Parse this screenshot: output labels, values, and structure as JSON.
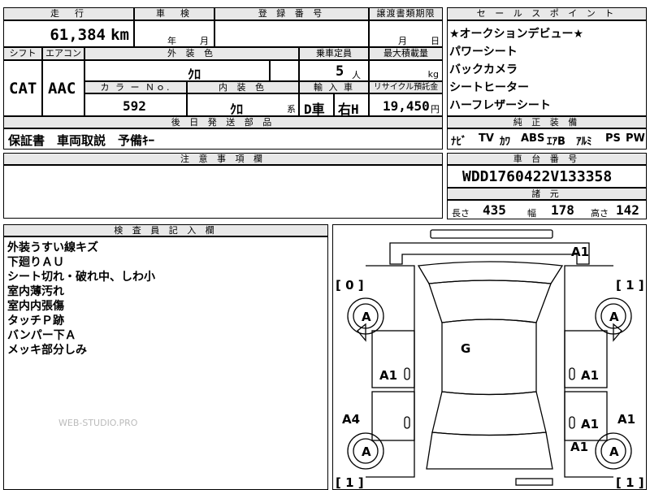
{
  "top": {
    "mileage_header": "走　行",
    "inspection_header": "車　検",
    "registration_header": "登 録 番 号",
    "transfer_header": "譲渡書類期限",
    "mileage_value": "61,384",
    "mileage_unit": "km",
    "year_label": "年",
    "month_label": "月",
    "transfer_month_label": "月",
    "transfer_day_label": "日"
  },
  "specs": {
    "shift_header": "シフト",
    "ac_header": "エアコン",
    "exterior_header": "外 装 色",
    "capacity_header": "乗車定員",
    "load_header": "最大積載量",
    "shift_value": "CAT",
    "ac_value": "AAC",
    "exterior_value": "ｸﾛ",
    "capacity_value": "5",
    "capacity_unit": "人",
    "load_unit": "kg",
    "color_no_header": "カ ラ ー Ｎｏ.",
    "interior_header": "内 装 色",
    "import_header": "輸 入 車",
    "recycle_header": "リサイクル預託金",
    "color_no_value": "592",
    "interior_value": "ｸﾛ",
    "interior_suffix": "系",
    "import_type": "D車",
    "steering": "右H",
    "recycle_value": "19,450",
    "recycle_unit": "円"
  },
  "later_parts": {
    "header": "後 日 発 送 部 品",
    "value": "保証書　車両取説　予備ｷｰ"
  },
  "sale_points": {
    "header": "セ ー ル ス ポ イ ン ト",
    "items": [
      "★オークションデビュー★",
      "パワーシート",
      "バックカメラ",
      "シートヒーター",
      "ハーフレザーシート"
    ]
  },
  "equipment": {
    "header": "純 正 装 備",
    "items": [
      "ﾅﾋﾞ",
      "TV",
      "ｶﾜ",
      "ABS",
      "ｴｱB",
      "ｱﾙﾐ",
      "PS",
      "PW"
    ]
  },
  "notes": {
    "header": "注 意 事 項 欄"
  },
  "chassis": {
    "header": "車 台 番 号",
    "value": "WDD1760422V133358",
    "dims_header": "諸 元",
    "length_label": "長さ",
    "length_value": "435",
    "width_label": "幅",
    "width_value": "178",
    "height_label": "高さ",
    "height_value": "142"
  },
  "inspector": {
    "header": "検 査 員 記 入 欄",
    "lines": [
      "外装うすい線キズ",
      "下廻りＡＵ",
      "シート切れ・破れ中、しわ小",
      "室内薄汚れ",
      "室内内張傷",
      "タッチＰ跡",
      "バンパー下Ａ",
      "メッキ部分しみ"
    ],
    "watermark": "WEB-STUDIO.PRO"
  },
  "diagram": {
    "marks": {
      "front_bumper": "A1",
      "left_front_tire": "[ 0 ]",
      "right_front_tire": "[ 1 ]",
      "left_front_wheel": "A",
      "right_front_wheel": "A",
      "roof": "G",
      "left_front_door": "A1",
      "right_front_door": "A1",
      "left_rear_quarter": "A4",
      "right_rear_door": "A1",
      "right_rear_quarter": "A1",
      "right_rear_fender": "A1",
      "left_rear_wheel": "A",
      "right_rear_wheel": "A",
      "left_rear_tire": "[ 1 ]",
      "right_rear_tire": "[ 1 ]"
    }
  }
}
